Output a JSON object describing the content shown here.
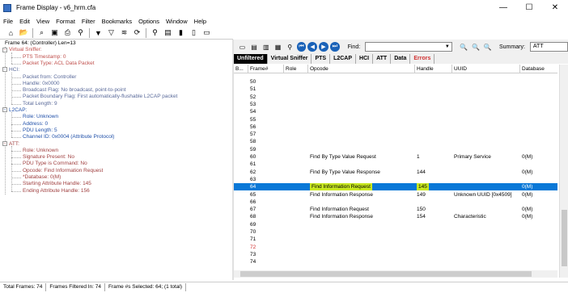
{
  "window": {
    "title": "Frame Display - v6_hrm.cfa",
    "min_icon": "minimize-icon",
    "max_icon": "maximize-icon",
    "close_icon": "close-icon"
  },
  "menu": [
    "File",
    "Edit",
    "View",
    "Format",
    "Filter",
    "Bookmarks",
    "Options",
    "Window",
    "Help"
  ],
  "left_toolbar_icons": [
    "home-icon",
    "open-folder-icon",
    "search-icon",
    "save-icon",
    "print-icon",
    "binoculars-icon",
    "filter-icon",
    "filter-clear-icon",
    "layers-icon",
    "refresh-icon",
    "find-icon",
    "note-icon",
    "bookmark-icon",
    "book-icon",
    "display-icon"
  ],
  "tree": {
    "root": "Frame 64: (Controller) Len=13",
    "sections": [
      {
        "name": "Virtual Sniffer",
        "items": [
          "PTS Timestamp: 0",
          "Packet Type: ACL Data Packet"
        ]
      },
      {
        "name": "HCI",
        "items": [
          "Packet from: Controller",
          "Handle: 0x0000",
          "Broadcast Flag: No broadcast, point-to-point",
          "Packet Boundary Flag: First automatically-flushable L2CAP packet",
          "Total Length: 9"
        ]
      },
      {
        "name": "L2CAP",
        "items": [
          "Role: Unknown",
          "Address: 0",
          "PDU Length: 5",
          "Channel ID: 0x0004  (Attribute Protocol)"
        ]
      },
      {
        "name": "ATT",
        "items": [
          "Role: Unknown",
          "Signature Present: No",
          "PDU Type is Command: No",
          "Opcode: Find Information Request",
          "*Database: 0(M)",
          "Starting Attribute Handle: 145",
          "Ending Attribute Handle: 156"
        ]
      }
    ]
  },
  "right_toolbar": {
    "find_label": "Find:",
    "find_value": "",
    "summary_label": "Summary:",
    "summary_value": "ATT"
  },
  "tabs": [
    "Unfiltered",
    "Virtual Sniffer",
    "PTS",
    "L2CAP",
    "HCI",
    "ATT",
    "Data",
    "Errors"
  ],
  "columns": [
    "B...",
    "Frame#",
    "Role",
    "Opcode",
    "Handle",
    "UUID",
    "Database"
  ],
  "rows": [
    {
      "frame": "50",
      "opcode": "",
      "handle": "",
      "uuid": "",
      "db": ""
    },
    {
      "frame": "51",
      "opcode": "",
      "handle": "",
      "uuid": "",
      "db": ""
    },
    {
      "frame": "52",
      "opcode": "",
      "handle": "",
      "uuid": "",
      "db": ""
    },
    {
      "frame": "53",
      "opcode": "",
      "handle": "",
      "uuid": "",
      "db": ""
    },
    {
      "frame": "54",
      "opcode": "",
      "handle": "",
      "uuid": "",
      "db": ""
    },
    {
      "frame": "55",
      "opcode": "",
      "handle": "",
      "uuid": "",
      "db": ""
    },
    {
      "frame": "56",
      "opcode": "",
      "handle": "",
      "uuid": "",
      "db": ""
    },
    {
      "frame": "57",
      "opcode": "",
      "handle": "",
      "uuid": "",
      "db": ""
    },
    {
      "frame": "58",
      "opcode": "",
      "handle": "",
      "uuid": "",
      "db": ""
    },
    {
      "frame": "59",
      "opcode": "",
      "handle": "",
      "uuid": "",
      "db": ""
    },
    {
      "frame": "60",
      "opcode": "Find By Type Value Request",
      "handle": "1",
      "uuid": "Primary Service",
      "db": "0(M)"
    },
    {
      "frame": "61",
      "opcode": "",
      "handle": "",
      "uuid": "",
      "db": ""
    },
    {
      "frame": "62",
      "opcode": "Find By Type Value Response",
      "handle": "144",
      "uuid": "",
      "db": "0(M)"
    },
    {
      "frame": "63",
      "opcode": "",
      "handle": "",
      "uuid": "",
      "db": ""
    },
    {
      "frame": "64",
      "opcode": "Find Information Request",
      "handle": "145",
      "uuid": "",
      "db": "0(M)",
      "selected": true
    },
    {
      "frame": "65",
      "opcode": "Find Information Response",
      "handle": "149",
      "uuid": "Unknown UUID [0x4509]",
      "db": "0(M)"
    },
    {
      "frame": "66",
      "opcode": "",
      "handle": "",
      "uuid": "",
      "db": ""
    },
    {
      "frame": "67",
      "opcode": "Find Information Request",
      "handle": "150",
      "uuid": "",
      "db": "0(M)"
    },
    {
      "frame": "68",
      "opcode": "Find Information Response",
      "handle": "154",
      "uuid": "Characteristic",
      "db": "0(M)"
    },
    {
      "frame": "69",
      "opcode": "",
      "handle": "",
      "uuid": "",
      "db": ""
    },
    {
      "frame": "70",
      "opcode": "",
      "handle": "",
      "uuid": "",
      "db": ""
    },
    {
      "frame": "71",
      "opcode": "",
      "handle": "",
      "uuid": "",
      "db": ""
    },
    {
      "frame": "72",
      "opcode": "",
      "handle": "",
      "uuid": "",
      "db": "",
      "red": true
    },
    {
      "frame": "73",
      "opcode": "",
      "handle": "",
      "uuid": "",
      "db": ""
    },
    {
      "frame": "74",
      "opcode": "",
      "handle": "",
      "uuid": "",
      "db": ""
    }
  ],
  "status": {
    "total": "Total Frames:  74",
    "filtered": "Frames Filtered In:  74",
    "selected": "Frame #s Selected:  64; (1 total)"
  }
}
